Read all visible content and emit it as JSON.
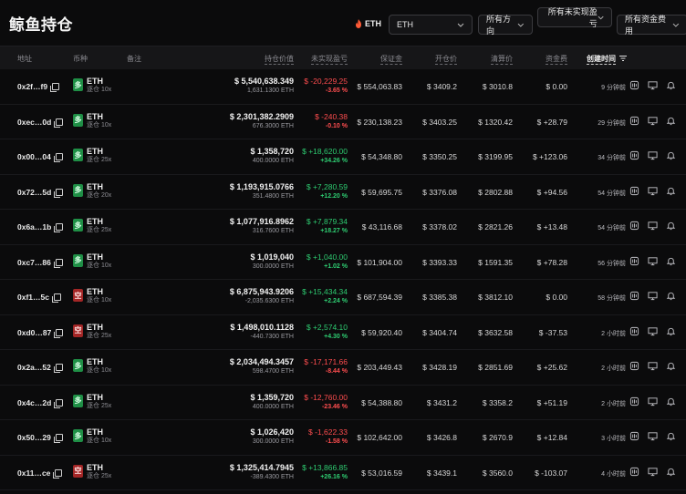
{
  "header": {
    "title": "鲸鱼持仓",
    "coin_badge": "ETH",
    "coin_select": "ETH",
    "direction_filter": "所有方向",
    "pnl_filter": "所有未实现盈亏",
    "funding_filter": "所有资金费用"
  },
  "columns": {
    "address": "地址",
    "coin": "币种",
    "note": "备注",
    "value": "持仓价值",
    "pnl": "未实现盈亏",
    "margin": "保证金",
    "open_price": "开仓价",
    "liq_price": "清算价",
    "funding": "资金费",
    "created": "创建时间"
  },
  "rows": [
    {
      "address": "0x2f…f9",
      "dir": "多",
      "dir_type": "long",
      "coin": "ETH",
      "leverage": "逐仓 10x",
      "value": "$ 5,540,638.349",
      "size": "1,631.1300 ETH",
      "pnl": "$ -20,229.25",
      "pnl_pct": "-3.65 %",
      "pnl_sign": "neg",
      "margin": "$ 554,063.83",
      "open": "$ 3409.2",
      "liq": "$ 3010.8",
      "funding": "$ 0.00",
      "funding_sign": "zero",
      "time": "9 分钟前"
    },
    {
      "address": "0xec…0d",
      "dir": "多",
      "dir_type": "long",
      "coin": "ETH",
      "leverage": "逐仓 10x",
      "value": "$ 2,301,382.2909",
      "size": "676.3000 ETH",
      "pnl": "$ -240.38",
      "pnl_pct": "-0.10 %",
      "pnl_sign": "neg",
      "margin": "$ 230,138.23",
      "open": "$ 3403.25",
      "liq": "$ 1320.42",
      "funding": "$ +28.79",
      "funding_sign": "pos",
      "time": "29 分钟前"
    },
    {
      "address": "0x00…04",
      "dir": "多",
      "dir_type": "long",
      "coin": "ETH",
      "leverage": "逐仓 25x",
      "value": "$ 1,358,720",
      "size": "400.0000 ETH",
      "pnl": "$ +18,620.00",
      "pnl_pct": "+34.26 %",
      "pnl_sign": "pos",
      "margin": "$ 54,348.80",
      "open": "$ 3350.25",
      "liq": "$ 3199.95",
      "funding": "$ +123.06",
      "funding_sign": "pos",
      "time": "34 分钟前"
    },
    {
      "address": "0x72…5d",
      "dir": "多",
      "dir_type": "long",
      "coin": "ETH",
      "leverage": "逐仓 20x",
      "value": "$ 1,193,915.0766",
      "size": "351.4800 ETH",
      "pnl": "$ +7,280.59",
      "pnl_pct": "+12.20 %",
      "pnl_sign": "pos",
      "margin": "$ 59,695.75",
      "open": "$ 3376.08",
      "liq": "$ 2802.88",
      "funding": "$ +94.56",
      "funding_sign": "pos",
      "time": "54 分钟前"
    },
    {
      "address": "0x6a…1b",
      "dir": "多",
      "dir_type": "long",
      "coin": "ETH",
      "leverage": "逐仓 25x",
      "value": "$ 1,077,916.8962",
      "size": "316.7600 ETH",
      "pnl": "$ +7,879.34",
      "pnl_pct": "+18.27 %",
      "pnl_sign": "pos",
      "margin": "$ 43,116.68",
      "open": "$ 3378.02",
      "liq": "$ 2821.26",
      "funding": "$ +13.48",
      "funding_sign": "pos",
      "time": "54 分钟前"
    },
    {
      "address": "0xc7…86",
      "dir": "多",
      "dir_type": "long",
      "coin": "ETH",
      "leverage": "逐仓 10x",
      "value": "$ 1,019,040",
      "size": "300.0000 ETH",
      "pnl": "$ +1,040.00",
      "pnl_pct": "+1.02 %",
      "pnl_sign": "pos",
      "margin": "$ 101,904.00",
      "open": "$ 3393.33",
      "liq": "$ 1591.35",
      "funding": "$ +78.28",
      "funding_sign": "pos",
      "time": "56 分钟前"
    },
    {
      "address": "0xf1…5c",
      "dir": "空",
      "dir_type": "short",
      "coin": "ETH",
      "leverage": "逐仓 10x",
      "value": "$ 6,875,943.9206",
      "size": "-2,035.6300 ETH",
      "pnl": "$ +15,434.34",
      "pnl_pct": "+2.24 %",
      "pnl_sign": "pos",
      "margin": "$ 687,594.39",
      "open": "$ 3385.38",
      "liq": "$ 3812.10",
      "funding": "$ 0.00",
      "funding_sign": "zero",
      "time": "58 分钟前"
    },
    {
      "address": "0xd0…87",
      "dir": "空",
      "dir_type": "short",
      "coin": "ETH",
      "leverage": "逐仓 25x",
      "value": "$ 1,498,010.1128",
      "size": "-440.7300 ETH",
      "pnl": "$ +2,574.10",
      "pnl_pct": "+4.30 %",
      "pnl_sign": "pos",
      "margin": "$ 59,920.40",
      "open": "$ 3404.74",
      "liq": "$ 3632.58",
      "funding": "$ -37.53",
      "funding_sign": "neg",
      "time": "2 小时前"
    },
    {
      "address": "0x2a…52",
      "dir": "多",
      "dir_type": "long",
      "coin": "ETH",
      "leverage": "逐仓 10x",
      "value": "$ 2,034,494.3457",
      "size": "598.4700 ETH",
      "pnl": "$ -17,171.66",
      "pnl_pct": "-8.44 %",
      "pnl_sign": "neg",
      "margin": "$ 203,449.43",
      "open": "$ 3428.19",
      "liq": "$ 2851.69",
      "funding": "$ +25.62",
      "funding_sign": "pos",
      "time": "2 小时前"
    },
    {
      "address": "0x4c…2d",
      "dir": "多",
      "dir_type": "long",
      "coin": "ETH",
      "leverage": "逐仓 25x",
      "value": "$ 1,359,720",
      "size": "400.0000 ETH",
      "pnl": "$ -12,760.00",
      "pnl_pct": "-23.46 %",
      "pnl_sign": "neg",
      "margin": "$ 54,388.80",
      "open": "$ 3431.2",
      "liq": "$ 3358.2",
      "funding": "$ +51.19",
      "funding_sign": "pos",
      "time": "2 小时前"
    },
    {
      "address": "0x50…29",
      "dir": "多",
      "dir_type": "long",
      "coin": "ETH",
      "leverage": "逐仓 10x",
      "value": "$ 1,026,420",
      "size": "300.0000 ETH",
      "pnl": "$ -1,622.33",
      "pnl_pct": "-1.58 %",
      "pnl_sign": "neg",
      "margin": "$ 102,642.00",
      "open": "$ 3426.8",
      "liq": "$ 2670.9",
      "funding": "$ +12.84",
      "funding_sign": "pos",
      "time": "3 小时前"
    },
    {
      "address": "0x11…ce",
      "dir": "空",
      "dir_type": "short",
      "coin": "ETH",
      "leverage": "逐仓 25x",
      "value": "$ 1,325,414.7945",
      "size": "-389.4300 ETH",
      "pnl": "$ +13,866.85",
      "pnl_pct": "+26.16 %",
      "pnl_sign": "pos",
      "margin": "$ 53,016.59",
      "open": "$ 3439.1",
      "liq": "$ 3560.0",
      "funding": "$ -103.07",
      "funding_sign": "neg",
      "time": "4 小时前"
    }
  ],
  "colors": {
    "positive": "#2ecc71",
    "negative": "#ff4d4f",
    "long": "#1f8f46",
    "short": "#a32626",
    "background": "#0b0b0c"
  },
  "icons": [
    "fire-icon",
    "chevron-down-icon",
    "copy-icon",
    "sort-icon",
    "wallet-icon",
    "monitor-icon",
    "alert-icon"
  ]
}
